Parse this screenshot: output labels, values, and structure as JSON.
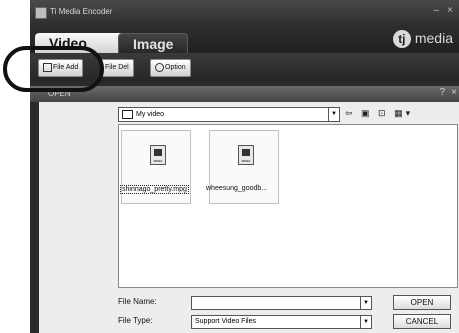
{
  "titlebar": {
    "title": "Ti Media Encoder",
    "minimize": "–",
    "close": "×"
  },
  "tabs": [
    {
      "label": "Video"
    },
    {
      "label": "Image"
    }
  ],
  "brand": {
    "logo": "tj",
    "name": "media"
  },
  "toolbar": {
    "file_add": "File Add",
    "file_del": "File Del",
    "option": "Option"
  },
  "dialog": {
    "title": "OPEN",
    "help": "?",
    "close": "×",
    "path": "My video",
    "nav_icons": "⇦ ▣ ⊡ ▦▾",
    "files": [
      {
        "name": "shinnago_pretty.mpg",
        "icon_label": "MPEG"
      },
      {
        "name": "wheesung_goodb...",
        "icon_label": "MPEG"
      }
    ],
    "file_name_label": "File Name:",
    "file_name_value": "",
    "file_type_label": "File Type:",
    "file_type_value": "Support Video Files",
    "open_button": "OPEN",
    "cancel_button": "CANCEL"
  }
}
